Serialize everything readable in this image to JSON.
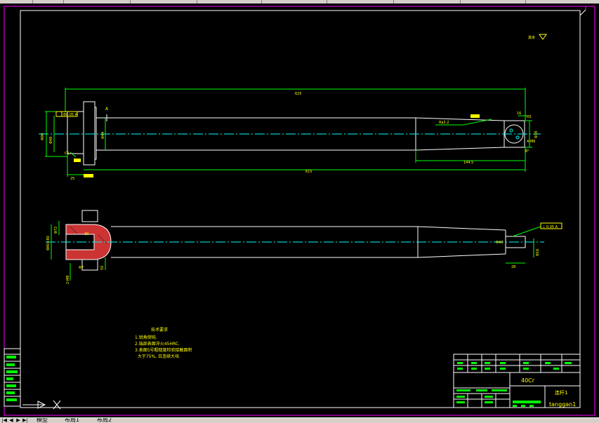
{
  "drawing": {
    "top_dimensions": {
      "overall_length": "625",
      "lower_length": "615",
      "taper_length": "144.5",
      "left_step": "25",
      "dia_a": "Φ90",
      "dia_b": "Φ48",
      "dia_c": "Φ44",
      "small_r": "R",
      "cham_left": "C1",
      "right_end_1": "R5",
      "right_end_2": "Φ38",
      "right_end_3": "4-M6",
      "right_end_4": "8°",
      "right_end_5": "16",
      "tol_box": "Φ0.05 A",
      "weld_label": "Ra3.2",
      "datum_label": "A"
    },
    "bottom_dimensions": {
      "left_dia": "Φ80×80",
      "left_hole": "30",
      "left_small": "Φ72",
      "left_depth": "50",
      "left_bottom_1": "2-M8",
      "left_bottom_2": "Φ7",
      "right_dia": "Φ40",
      "right_len": "28",
      "right_small": "Φ16",
      "right_tol": "⊥ 0.05 A"
    },
    "surface_note": "其余",
    "tech_requirements": {
      "title": "技术要求",
      "lines": [
        "1.锐角倒钝.",
        "2.端部表面淬火45HRC.",
        "3.表面5号粗糙度检验接触面积",
        "  大于75%, 且连续大块."
      ]
    },
    "title_block": {
      "material": "40Cr",
      "part_name": "连杆1",
      "designer": "tanggan1"
    }
  },
  "status_bar": {
    "tabs": [
      "模型",
      "布局1",
      "布局2"
    ],
    "nav_first": "|◀",
    "nav_prev": "◀",
    "nav_next": "▶",
    "nav_last": "▶|"
  },
  "colors": {
    "background": "#000000",
    "frame": "#ffffff",
    "outer_frame": "#ff00ff",
    "dimension": "#00ff00",
    "centerline": "#00ffff",
    "text": "#ffff00",
    "hatch": "#cc3333"
  }
}
